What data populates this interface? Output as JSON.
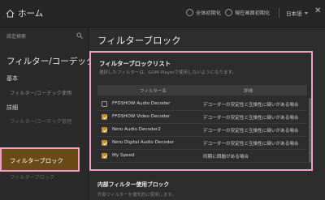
{
  "header": {
    "home_label": "ホーム",
    "reset_all_label": "全体初期化",
    "reset_screen_label": "現在画面初期化",
    "language": "日本語"
  },
  "sidebar": {
    "search_placeholder": "設定検索",
    "title": "フィルター/コーデック",
    "categories": [
      {
        "label": "基本",
        "items": [
          "フィルター/コーデック使用"
        ]
      },
      {
        "label": "詳細",
        "items": [
          "フィルター/コーデック管理",
          "フィルターブロック",
          "フィルターブロック"
        ]
      }
    ],
    "active_item": "フィルターブロック"
  },
  "main": {
    "page_title": "フィルターブロック",
    "panel": {
      "title": "フィルターブロックリスト",
      "description": "選択したフィルターは、GOM Playerで使用しないようになります。",
      "columns": [
        "フィルター名",
        "詳細"
      ],
      "rows": [
        {
          "name": "FFDSHOW Audio Decoder",
          "detail": "デコーダーの安定性と互換性に疑いがある場合",
          "checked": false
        },
        {
          "name": "FFDSHOW Video Decoder",
          "detail": "デコーダーの安定性と互換性に疑いがある場合",
          "checked": true
        },
        {
          "name": "Nero Audio Decoder2",
          "detail": "デコーダーの安定性と互換性に疑いがある場合",
          "checked": true
        },
        {
          "name": "Nero Digital Audio Decoder",
          "detail": "デコーダーの安定性と互換性に疑いがある場合",
          "checked": true
        },
        {
          "name": "My Speed",
          "detail": "同期に問題がある場合",
          "checked": true
        }
      ]
    },
    "section2": {
      "title": "内部フィルター使用ブロック",
      "description": "外部フィルターを優先的に使用します。"
    }
  },
  "colors": {
    "accent": "#c98a1e",
    "highlight_border": "#f0a0c8",
    "background": "#2b2b2b"
  }
}
